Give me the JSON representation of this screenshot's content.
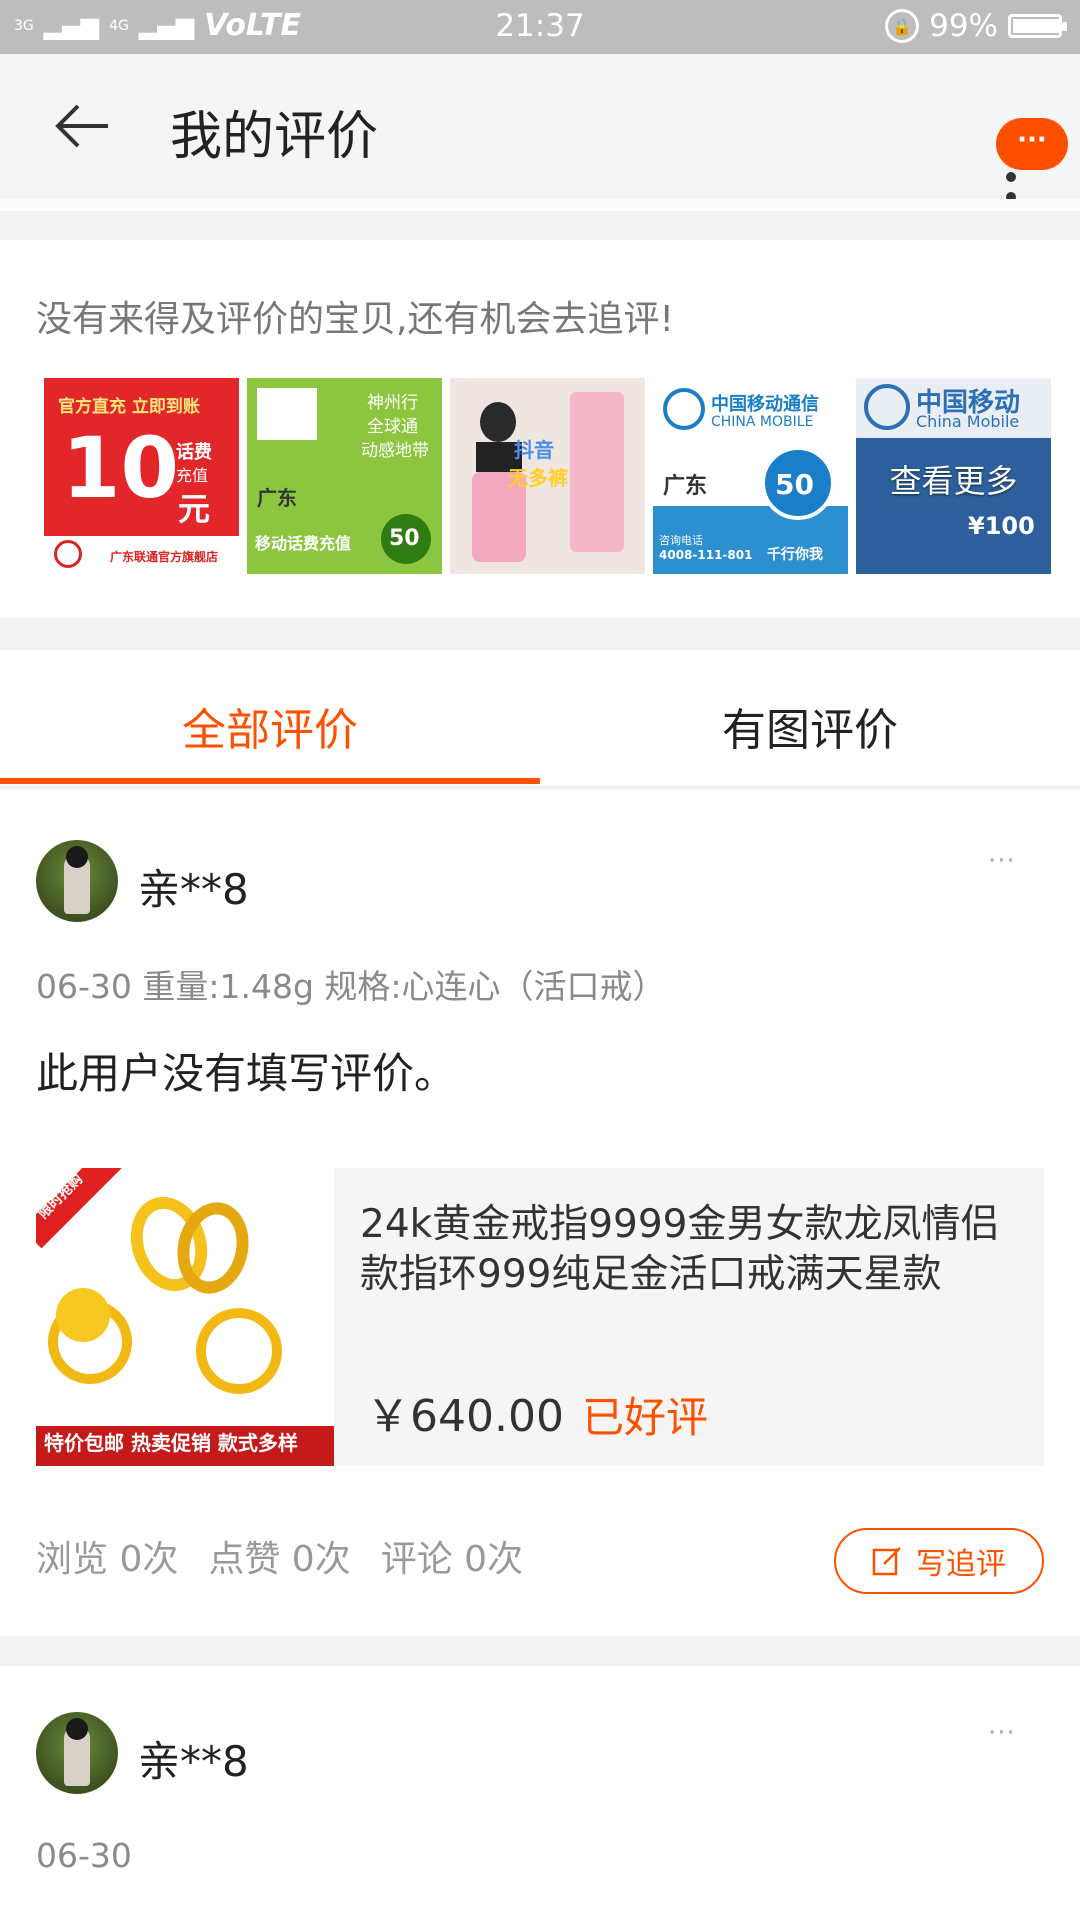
{
  "status_bar": {
    "network": "VoLTE",
    "signal_labels": [
      "3G",
      "4G"
    ],
    "time": "21:37",
    "battery": "99%"
  },
  "header": {
    "title": "我的评价",
    "bubble_label": "···"
  },
  "recommend": {
    "tip": "没有来得及评价的宝贝,还有机会去追评!",
    "thumbs": [
      {
        "icon": "unicom-10-recharge-image",
        "texts": [
          "官方直充 立即到账",
          "10",
          "话费",
          "充值",
          "元",
          "广东联通官方旗舰店"
        ]
      },
      {
        "icon": "mobile-50-recharge-image",
        "texts": [
          "神州行",
          "全球通",
          "动感地带",
          "广东",
          "移动话费充值",
          "50"
        ]
      },
      {
        "icon": "pink-pants-image",
        "texts": [
          "抖音",
          "无多裤"
        ]
      },
      {
        "icon": "china-mobile-50-image",
        "texts": [
          "中国移动通信",
          "CHINA MOBILE",
          "广东",
          "50",
          "咨询电话",
          "4008-111-801",
          "千行你我"
        ]
      },
      {
        "icon": "china-mobile-100-image",
        "texts": [
          "中国移动",
          "China Mobile",
          "¥100"
        ]
      }
    ],
    "see_more": "查看更多"
  },
  "tabs": [
    {
      "label": "全部评价",
      "active": true
    },
    {
      "label": "有图评价",
      "active": false
    }
  ],
  "reviews": [
    {
      "username": "亲**8",
      "more": "···",
      "meta": "06-30  重量:1.48g 规格:心连心（活口戒）",
      "text": "此用户没有填写评价。",
      "product": {
        "title": "24k黄金戒指9999金男女款龙凤情侣款指环999纯足金活口戒满天星款",
        "price": "￥640.00",
        "status": "已好评",
        "image_texts": [
          "限时抢购",
          "特价包邮 热卖促销 款式多样"
        ]
      },
      "stats": [
        "浏览 0次",
        "点赞 0次",
        "评论 0次"
      ],
      "follow_button": "写追评"
    },
    {
      "username": "亲**8",
      "more": "···",
      "meta": "06-30"
    }
  ],
  "colors": {
    "accent": "#ff5000",
    "status_bar": "#bdbdbd",
    "header_bg": "#f5f5f5"
  }
}
